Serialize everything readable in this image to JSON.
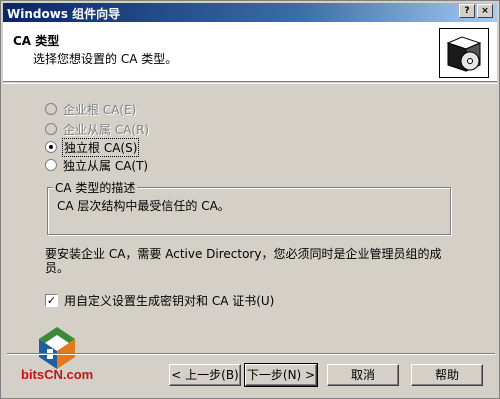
{
  "window": {
    "title": "Windows 组件向导"
  },
  "header": {
    "title": "CA 类型",
    "subtitle": "选择您想设置的 CA 类型。"
  },
  "options": [
    {
      "label": "企业根 CA(E)",
      "enabled": false,
      "selected": false
    },
    {
      "label": "企业从属 CA(R)",
      "enabled": false,
      "selected": false
    },
    {
      "label": "独立根 CA(S)",
      "enabled": true,
      "selected": true
    },
    {
      "label": "独立从属 CA(T)",
      "enabled": true,
      "selected": false
    }
  ],
  "description_group": {
    "title": "CA 类型的描述",
    "text": "CA 层次结构中最受信任的 CA。"
  },
  "note": "要安装企业 CA，需要 Active Directory，您必须同时是企业管理员组的成员。",
  "custom_keys": {
    "label": "用自定义设置生成密钥对和 CA 证书(U)",
    "checked": true
  },
  "buttons": {
    "back": "< 上一步(B)",
    "next": "下一步(N) >",
    "cancel": "取消",
    "help": "帮助"
  },
  "watermark": {
    "text": "bitsCN.com"
  }
}
